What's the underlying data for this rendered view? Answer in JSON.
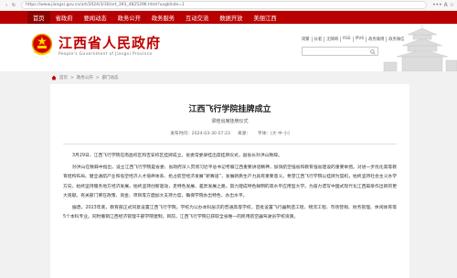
{
  "browser": {
    "url": "https://www.jiangxi.gov.cn/art/2024/3/30/art_393_4825296.html?xxgkhide=1",
    "menu_label": "••• A ☆"
  },
  "nav": {
    "items": [
      "首页",
      "省政府",
      "要闻动态",
      "政务公开",
      "政务服务",
      "互动交流",
      "数据开放",
      "美丽江西"
    ]
  },
  "header": {
    "brand_cn": "江西省人民政府",
    "brand_en": "People's Government of Jiangxi Province",
    "toolbar": [
      "简繁",
      "长者",
      "无障碍",
      "RSS",
      "IPV6",
      "政务微博",
      "政务微信"
    ],
    "search_placeholder": ""
  },
  "breadcrumb": [
    "首页",
    "政务公开",
    "部门动态"
  ],
  "article": {
    "title": "江西飞行学院挂牌成立",
    "subtitle": "梁桂出席挂牌仪式",
    "date_label": "发布时间：2024-03-30 07:23",
    "source_label": "来源：",
    "font_size_label": "字体：[大 中 小]",
    "paragraphs": [
      "3月29日，江西飞行学院在南昌校区和吉安校区挂牌成立。省委常委梁桂出席挂牌仪式，副省长孙洪山致辞。",
      "孙洪山在致辞中指出，设立江西飞行学院是省委、省政府深入贯彻习近平总书记考察江西重要讲话精神，加快航空强省和教育强省建设的重要举措。对进一步优化高等教育结构布局、健全通航产业和低空经济人才培养体系、抢占航空经济发展“新赛道”，发展新质生产力具有重要意义。希望江西飞行学院以挂牌为契机，始终坚持社会主义办学方向，始终坚持服务地方经济发展，始终坚持创新驱动，走特色发展、差异发展之路，努力建成特色鲜明的高水平应用型大学。为奋力谱写中国式现代化江西篇章作出新的更大贡献。有关部门要在政策、资金、项目等方面加大支持力度，确保学院办出特色、办出水平。",
      "据悉，2023年底，教育部正式同意设置江西飞行学院。学校为公办本科层次的普通高等学校，首批设置飞行器制造工程、物流工程、市场营销、财务管理、休闲体育等5个本科专业。同时撤销江西经济管理干部学院建制。目前，江西飞行学院已获取全省唯一的民用航空器驾驶员学校资质。"
    ]
  },
  "colors": {
    "brand_red": "#b90000",
    "title_red": "#c00000"
  }
}
